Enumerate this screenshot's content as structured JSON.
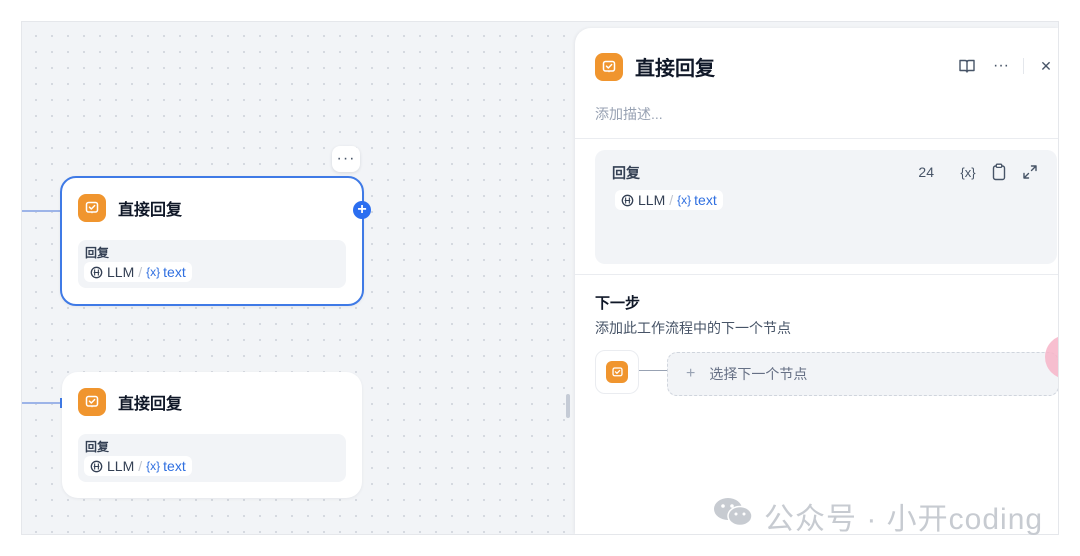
{
  "canvas": {
    "nodes": [
      {
        "title": "直接回复",
        "field_label": "回复",
        "source": "LLM",
        "separator": "/",
        "var_brace": "{x}",
        "var_name": "text"
      },
      {
        "title": "直接回复",
        "field_label": "回复",
        "source": "LLM",
        "separator": "/",
        "var_brace": "{x}",
        "var_name": "text"
      }
    ],
    "more_label": "···",
    "add_label": "+"
  },
  "panel": {
    "title": "直接回复",
    "description_placeholder": "添加描述...",
    "reply": {
      "label": "回复",
      "char_count": "24",
      "var_button": "{x}",
      "source": "LLM",
      "separator": "/",
      "var_brace": "{x}",
      "var_name": "text"
    },
    "next_step": {
      "title": "下一步",
      "subtitle": "添加此工作流程中的下一个节点",
      "select_label": "选择下一个节点",
      "plus": "+"
    },
    "more_label": "···",
    "close_label": "✕"
  },
  "watermark": {
    "text": "公众号 · 小开coding"
  },
  "colors": {
    "accent": "#3f7ae6",
    "node_icon": "#f0952e",
    "variable": "#2f6fe0"
  }
}
